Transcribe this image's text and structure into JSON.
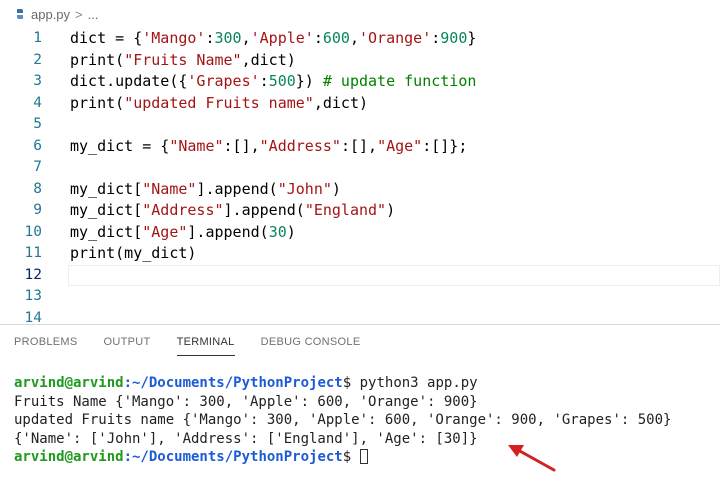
{
  "breadcrumb": {
    "file": "app.py",
    "separator": ">",
    "ellipsis": "..."
  },
  "editor": {
    "lines": [
      {
        "num": "1",
        "tokens": [
          {
            "t": "dict = {",
            "c": ""
          },
          {
            "t": "'Mango'",
            "c": "s"
          },
          {
            "t": ":",
            "c": ""
          },
          {
            "t": "300",
            "c": "n"
          },
          {
            "t": ",",
            "c": ""
          },
          {
            "t": "'Apple'",
            "c": "s"
          },
          {
            "t": ":",
            "c": ""
          },
          {
            "t": "600",
            "c": "n"
          },
          {
            "t": ",",
            "c": ""
          },
          {
            "t": "'Orange'",
            "c": "s"
          },
          {
            "t": ":",
            "c": ""
          },
          {
            "t": "900",
            "c": "n"
          },
          {
            "t": "}",
            "c": ""
          }
        ]
      },
      {
        "num": "2",
        "tokens": [
          {
            "t": "print(",
            "c": ""
          },
          {
            "t": "\"Fruits Name\"",
            "c": "s"
          },
          {
            "t": ",dict)",
            "c": ""
          }
        ]
      },
      {
        "num": "3",
        "tokens": [
          {
            "t": "dict.update({",
            "c": ""
          },
          {
            "t": "'Grapes'",
            "c": "s"
          },
          {
            "t": ":",
            "c": ""
          },
          {
            "t": "500",
            "c": "n"
          },
          {
            "t": "}) ",
            "c": ""
          },
          {
            "t": "# update function",
            "c": "c"
          }
        ]
      },
      {
        "num": "4",
        "tokens": [
          {
            "t": "print(",
            "c": ""
          },
          {
            "t": "\"updated Fruits name\"",
            "c": "s"
          },
          {
            "t": ",dict)",
            "c": ""
          }
        ]
      },
      {
        "num": "5",
        "tokens": []
      },
      {
        "num": "6",
        "tokens": [
          {
            "t": "my_dict = {",
            "c": ""
          },
          {
            "t": "\"Name\"",
            "c": "s"
          },
          {
            "t": ":[],",
            "c": ""
          },
          {
            "t": "\"Address\"",
            "c": "s"
          },
          {
            "t": ":[],",
            "c": ""
          },
          {
            "t": "\"Age\"",
            "c": "s"
          },
          {
            "t": ":[]};",
            "c": ""
          }
        ]
      },
      {
        "num": "7",
        "tokens": []
      },
      {
        "num": "8",
        "tokens": [
          {
            "t": "my_dict[",
            "c": ""
          },
          {
            "t": "\"Name\"",
            "c": "s"
          },
          {
            "t": "].append(",
            "c": ""
          },
          {
            "t": "\"John\"",
            "c": "s"
          },
          {
            "t": ")",
            "c": ""
          }
        ]
      },
      {
        "num": "9",
        "tokens": [
          {
            "t": "my_dict[",
            "c": ""
          },
          {
            "t": "\"Address\"",
            "c": "s"
          },
          {
            "t": "].append(",
            "c": ""
          },
          {
            "t": "\"England\"",
            "c": "s"
          },
          {
            "t": ")",
            "c": ""
          }
        ]
      },
      {
        "num": "10",
        "tokens": [
          {
            "t": "my_dict[",
            "c": ""
          },
          {
            "t": "\"Age\"",
            "c": "s"
          },
          {
            "t": "].append(",
            "c": ""
          },
          {
            "t": "30",
            "c": "n"
          },
          {
            "t": ")",
            "c": ""
          }
        ]
      },
      {
        "num": "11",
        "tokens": [
          {
            "t": "print(my_dict)",
            "c": ""
          }
        ]
      },
      {
        "num": "12",
        "tokens": [],
        "active": true
      },
      {
        "num": "13",
        "tokens": []
      },
      {
        "num": "14",
        "tokens": []
      }
    ]
  },
  "panel": {
    "tabs": [
      {
        "label": "PROBLEMS",
        "active": false
      },
      {
        "label": "OUTPUT",
        "active": false
      },
      {
        "label": "TERMINAL",
        "active": true
      },
      {
        "label": "DEBUG CONSOLE",
        "active": false
      }
    ]
  },
  "terminal": {
    "prompt_user": "arvind@arvind",
    "prompt_path": ":~/Documents/PythonProject",
    "prompt_symbol": "$",
    "command": " python3 app.py",
    "output": [
      "Fruits Name {'Mango': 300, 'Apple': 600, 'Orange': 900}",
      "updated Fruits name {'Mango': 300, 'Apple': 600, 'Orange': 900, 'Grapes': 500}",
      "{'Name': ['John'], 'Address': ['England'], 'Age': [30]}"
    ]
  },
  "colors": {
    "arrow": "#d42020",
    "prompt_user": "#1f9a1f",
    "prompt_path": "#1c5bd6"
  },
  "icons": {
    "file": "python-file-icon",
    "annotation": "red-arrow-icon"
  }
}
